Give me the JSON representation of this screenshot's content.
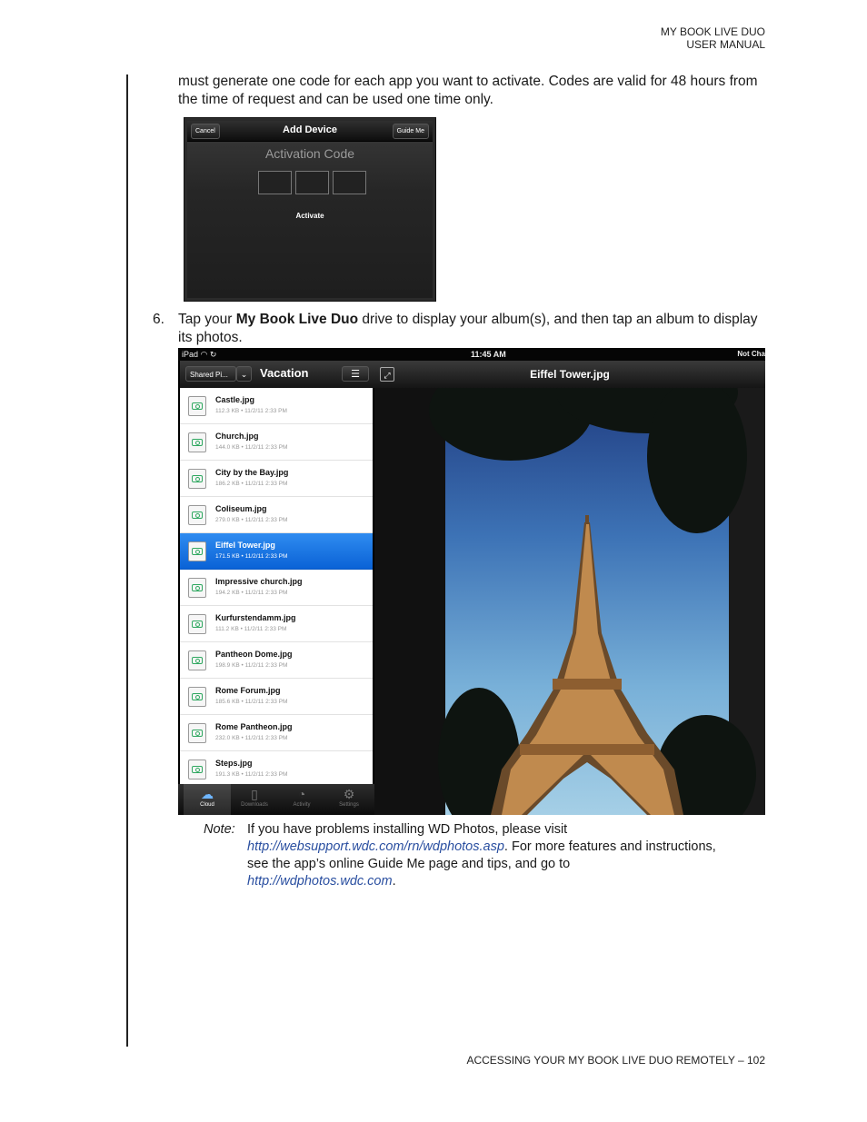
{
  "header": {
    "line1": "MY BOOK LIVE DUO",
    "line2": "USER MANUAL"
  },
  "intro_text": "must generate one code for each app you want to activate. Codes are valid for 48 hours from the time of request and can be used one time only.",
  "activation_screen": {
    "cancel_label": "Cancel",
    "title": "Add Device",
    "guide_label": "Guide Me",
    "code_label": "Activation Code",
    "activate_label": "Activate"
  },
  "step6": {
    "number": "6.",
    "prefix": "Tap your ",
    "bold": "My Book Live Duo",
    "suffix": " drive to display your album(s), and then tap an album to display its photos."
  },
  "ipad": {
    "status_left": "iPad",
    "status_time": "11:45 AM",
    "status_right": "Not Cha",
    "shared_label": "Shared Pi...",
    "album_title": "Vacation",
    "photo_title": "Eiffel Tower.jpg",
    "files": [
      {
        "name": "Castle.jpg",
        "meta": "112.3 KB  •  11/2/11 2:33 PM",
        "selected": false
      },
      {
        "name": "Church.jpg",
        "meta": "144.0 KB  •  11/2/11 2:33 PM",
        "selected": false
      },
      {
        "name": "City by the Bay.jpg",
        "meta": "186.2 KB  •  11/2/11 2:33 PM",
        "selected": false
      },
      {
        "name": "Coliseum.jpg",
        "meta": "279.0 KB  •  11/2/11 2:33 PM",
        "selected": false
      },
      {
        "name": "Eiffel Tower.jpg",
        "meta": "171.5 KB  •  11/2/11 2:33 PM",
        "selected": true
      },
      {
        "name": "Impressive church.jpg",
        "meta": "194.2 KB  •  11/2/11 2:33 PM",
        "selected": false
      },
      {
        "name": "Kurfurstendamm.jpg",
        "meta": "111.2 KB  •  11/2/11 2:33 PM",
        "selected": false
      },
      {
        "name": "Pantheon Dome.jpg",
        "meta": "198.9 KB  •  11/2/11 2:33 PM",
        "selected": false
      },
      {
        "name": "Rome Forum.jpg",
        "meta": "185.6 KB  •  11/2/11 2:33 PM",
        "selected": false
      },
      {
        "name": "Rome Pantheon.jpg",
        "meta": "232.0 KB  •  11/2/11 2:33 PM",
        "selected": false
      },
      {
        "name": "Steps.jpg",
        "meta": "191.3 KB  •  11/2/11 2:33 PM",
        "selected": false
      }
    ],
    "tabs": [
      {
        "label": "Cloud",
        "icon": "cloud-icon",
        "active": true
      },
      {
        "label": "Downloads",
        "icon": "downloads-icon",
        "active": false
      },
      {
        "label": "Activity",
        "icon": "activity-icon",
        "active": false
      },
      {
        "label": "Settings",
        "icon": "gear-icon",
        "active": false
      }
    ]
  },
  "note": {
    "label": "Note:",
    "text1": "If you have problems installing WD Photos, please visit",
    "link1": "http://websupport.wdc.com/rn/wdphotos.asp",
    "text2": ". For more features and instructions, see the app’s online Guide Me page and tips, and go to",
    "link2": "http://wdphotos.wdc.com",
    "text3": "."
  },
  "footer": "ACCESSING YOUR MY BOOK LIVE DUO REMOTELY – 102",
  "colors": {
    "selection_blue": "#0a62d6",
    "link": "#2a4fa0",
    "icon_green": "#2fa860"
  }
}
